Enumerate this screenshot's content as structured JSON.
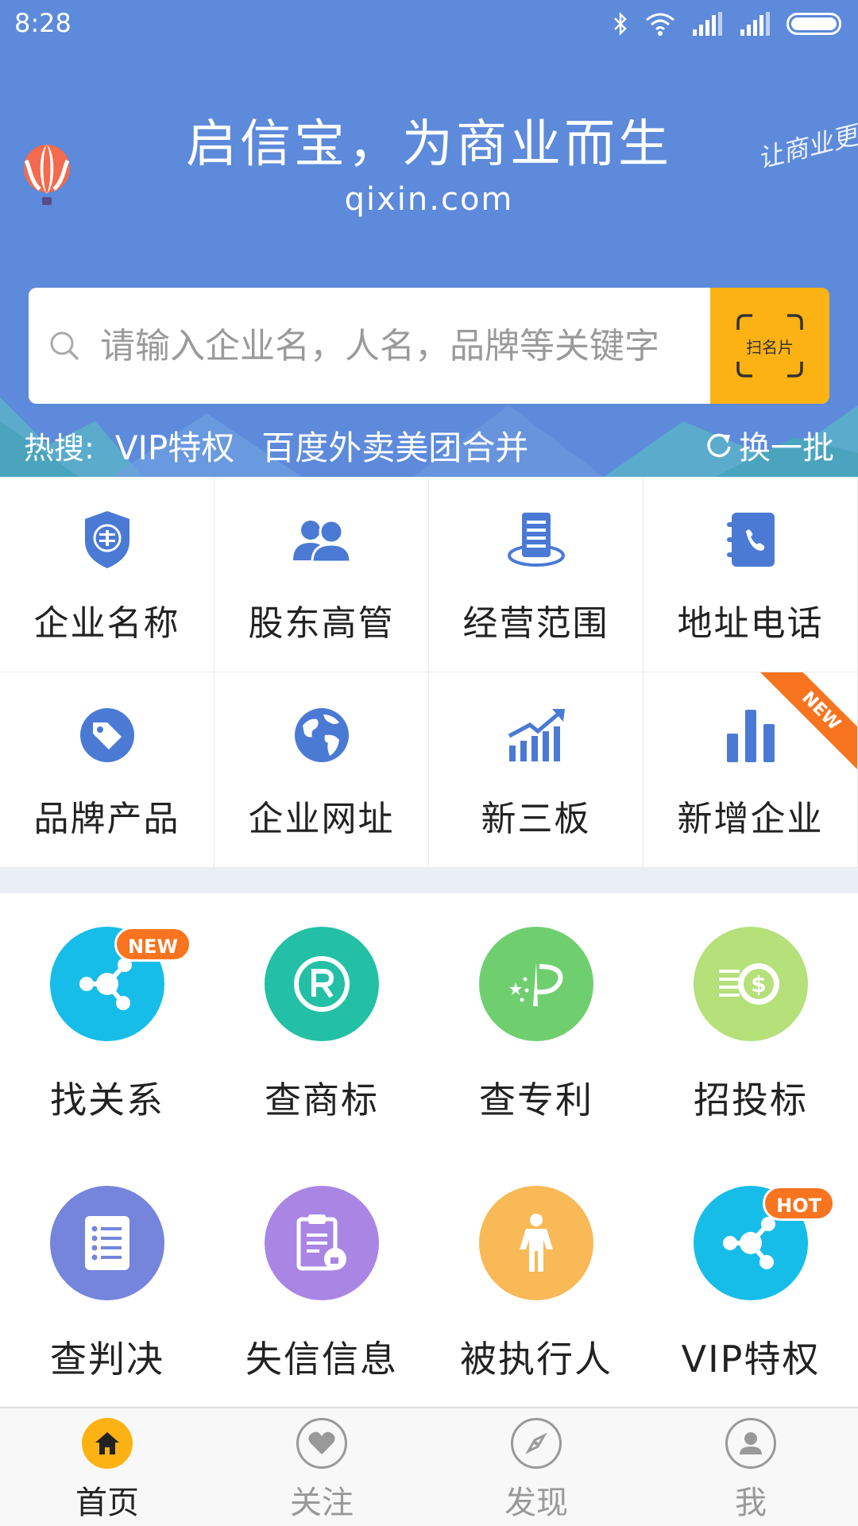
{
  "status_bar": {
    "time": "8:28"
  },
  "header": {
    "slogan": "启信宝，为商业而生",
    "site": "qixin.com",
    "script_text": "让商业更"
  },
  "search": {
    "placeholder": "请输入企业名，人名，品牌等关键字",
    "scan_label": "扫名片"
  },
  "hot_search": {
    "label": "热搜:",
    "keywords": [
      "VIP特权",
      "百度外卖美团合并"
    ],
    "refresh_label": "换一批"
  },
  "categories": [
    {
      "label": "企业名称",
      "icon": "enterprise-shield-icon"
    },
    {
      "label": "股东高管",
      "icon": "people-icon"
    },
    {
      "label": "经营范围",
      "icon": "document-icon"
    },
    {
      "label": "地址电话",
      "icon": "phone-book-icon"
    },
    {
      "label": "品牌产品",
      "icon": "tag-icon"
    },
    {
      "label": "企业网址",
      "icon": "globe-icon"
    },
    {
      "label": "新三板",
      "icon": "trend-chart-icon"
    },
    {
      "label": "新增企业",
      "icon": "bar-chart-icon",
      "ribbon": "NEW"
    }
  ],
  "tools": [
    {
      "label": "找关系",
      "icon": "network-icon",
      "color": "#17bde9",
      "badge": "NEW"
    },
    {
      "label": "查商标",
      "icon": "trademark-icon",
      "color": "#23c0a5"
    },
    {
      "label": "查专利",
      "icon": "patent-icon",
      "color": "#6fcf6f"
    },
    {
      "label": "招投标",
      "icon": "money-icon",
      "color": "#b5e07a"
    },
    {
      "label": "查判决",
      "icon": "list-icon",
      "color": "#7585dc"
    },
    {
      "label": "失信信息",
      "icon": "clipboard-icon",
      "color": "#a986e4"
    },
    {
      "label": "被执行人",
      "icon": "person-icon",
      "color": "#f9b956"
    },
    {
      "label": "VIP特权",
      "icon": "vip-network-icon",
      "color": "#17bde9",
      "badge": "HOT"
    }
  ],
  "tabs": [
    {
      "label": "首页",
      "icon": "home-icon",
      "active": true
    },
    {
      "label": "关注",
      "icon": "heart-icon",
      "active": false
    },
    {
      "label": "发现",
      "icon": "compass-icon",
      "active": false
    },
    {
      "label": "我",
      "icon": "user-icon",
      "active": false
    }
  ],
  "colors": {
    "header_bg": "#5d8ada",
    "accent": "#fcb213",
    "icon_blue": "#4a7ad4",
    "badge": "#f8741f"
  }
}
